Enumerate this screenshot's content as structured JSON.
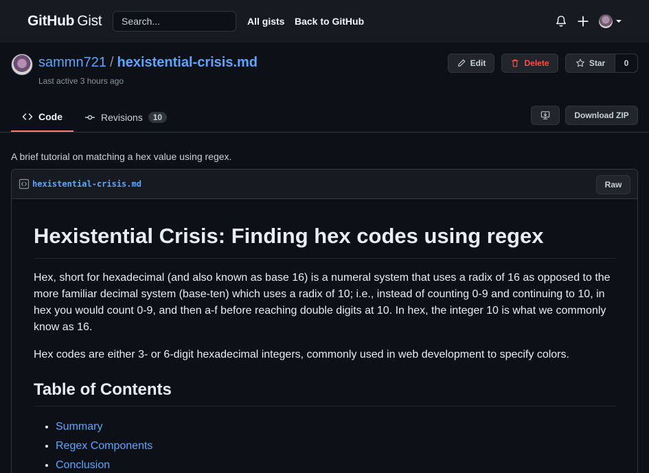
{
  "topbar": {
    "logo_main": "GitHub",
    "logo_sub": "Gist",
    "search_placeholder": "Search...",
    "links": [
      "All gists",
      "Back to GitHub"
    ]
  },
  "gist": {
    "owner": "sammn721",
    "separator": "/",
    "filename": "hexistential-crisis.md",
    "last_active": "Last active 3 hours ago",
    "actions": {
      "edit": "Edit",
      "delete": "Delete",
      "star": "Star",
      "star_count": "0"
    }
  },
  "tabs": {
    "code": "Code",
    "revisions": "Revisions",
    "revisions_count": "10",
    "download": "Download ZIP"
  },
  "description": "A brief tutorial on matching a hex value using regex.",
  "file": {
    "name": "hexistential-crisis.md",
    "raw_label": "Raw"
  },
  "content": {
    "title": "Hexistential Crisis: Finding hex codes using regex",
    "paragraph1": "Hex, short for hexadecimal (and also known as base 16) is a numeral system that uses a radix of 16 as opposed to the more familiar decimal system (base-ten) which uses a radix of 10; i.e., instead of counting 0-9 and continuing to 10, in hex you would count 0-9, and then a-f before reaching double digits at 10. In hex, the integer 10 is what we commonly know as 16.",
    "paragraph2": "Hex codes are either 3- or 6-digit hexadecimal integers, commonly used in web development to specify colors.",
    "toc_heading": "Table of Contents",
    "toc": [
      "Summary",
      "Regex Components",
      "Conclusion"
    ]
  },
  "colors": {
    "background": "#0d1117",
    "header": "#161b22",
    "link": "#58a6ff",
    "danger": "#f85149",
    "tab_underline": "#f78166"
  }
}
